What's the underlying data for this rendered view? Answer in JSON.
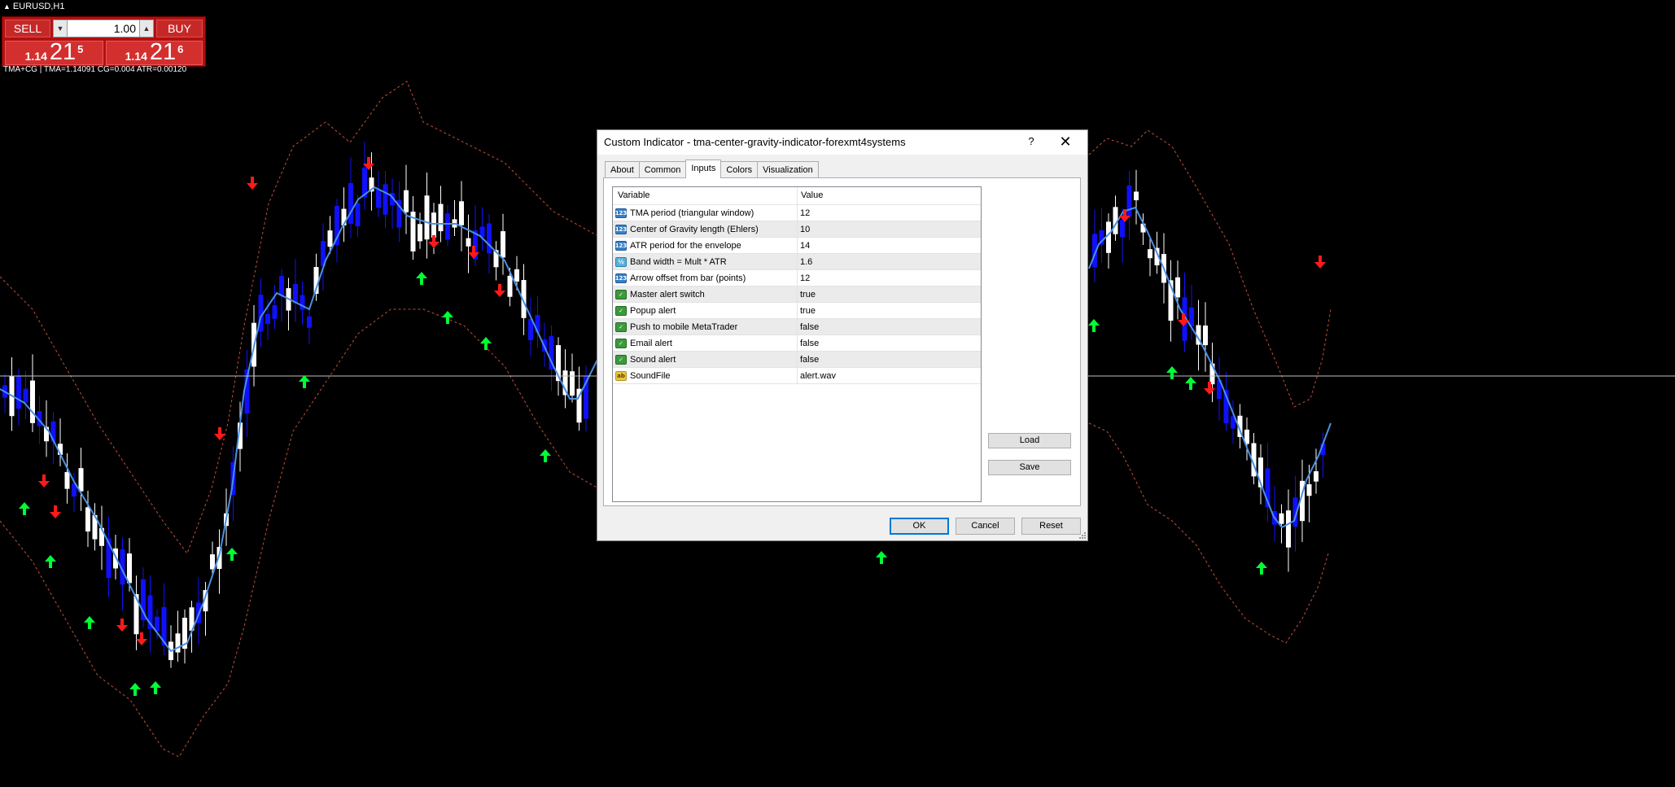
{
  "chart": {
    "symbol": "EURUSD,H1",
    "indicator_line": "TMA+CG | TMA=1.14091  CG=0.004  ATR=0.00120",
    "colors": {
      "background": "#000000",
      "bull_candle": "#ffffff",
      "bear_candle": "#1010ff",
      "center_line": "#4a90e2",
      "bands": "#c0503a",
      "arrow_up": "#00ff33",
      "arrow_down": "#ff1a1a",
      "price_line": "#c0c0c0"
    }
  },
  "trade_panel": {
    "sell_label": "SELL",
    "buy_label": "BUY",
    "lot": "1.00",
    "sell_price": {
      "small": "1.14",
      "big": "21",
      "sup": "5"
    },
    "buy_price": {
      "small": "1.14",
      "big": "21",
      "sup": "6"
    }
  },
  "dialog": {
    "title": "Custom Indicator - tma-center-gravity-indicator-forexmt4systems",
    "help": "?",
    "close": "✕",
    "tabs": [
      "About",
      "Common",
      "Inputs",
      "Colors",
      "Visualization"
    ],
    "active_tab": "Inputs",
    "columns": {
      "variable": "Variable",
      "value": "Value"
    },
    "params": [
      {
        "icon": "int-icon",
        "icon_text": "123",
        "name": "TMA period (triangular window)",
        "value": "12"
      },
      {
        "icon": "int-icon",
        "icon_text": "123",
        "name": "Center of Gravity length (Ehlers)",
        "value": "10"
      },
      {
        "icon": "int-icon",
        "icon_text": "123",
        "name": "ATR period for the envelope",
        "value": "14"
      },
      {
        "icon": "double-icon",
        "icon_text": "½",
        "name": "Band width = Mult * ATR",
        "value": "1.6"
      },
      {
        "icon": "int-icon",
        "icon_text": "123",
        "name": "Arrow offset from bar (points)",
        "value": "12"
      },
      {
        "icon": "bool-icon",
        "icon_text": "✓",
        "name": "Master alert switch",
        "value": "true"
      },
      {
        "icon": "bool-icon",
        "icon_text": "✓",
        "name": "Popup alert",
        "value": "true"
      },
      {
        "icon": "bool-icon",
        "icon_text": "✓",
        "name": "Push to mobile MetaTrader",
        "value": "false"
      },
      {
        "icon": "bool-icon",
        "icon_text": "✓",
        "name": "Email alert",
        "value": "false"
      },
      {
        "icon": "bool-icon",
        "icon_text": "✓",
        "name": "Sound alert",
        "value": "false"
      },
      {
        "icon": "string-icon",
        "icon_text": "ab",
        "name": "SoundFile",
        "value": "alert.wav"
      }
    ],
    "load_label": "Load",
    "save_label": "Save",
    "ok_label": "OK",
    "cancel_label": "Cancel",
    "reset_label": "Reset"
  }
}
